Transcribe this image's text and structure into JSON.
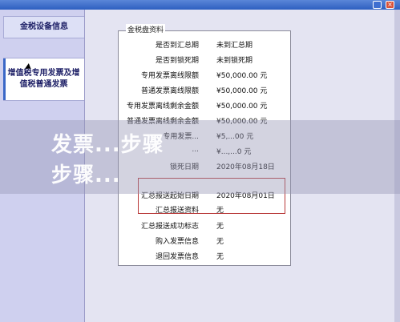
{
  "sidebar": {
    "items": [
      {
        "label": "金税设备信息"
      },
      {
        "label": "增值税专用发票及增值税普通发票"
      }
    ]
  },
  "panel": {
    "title": "金税盘资料",
    "rows": [
      {
        "label": "是否到汇总期",
        "value": "未到汇总期"
      },
      {
        "label": "是否到锁死期",
        "value": "未到锁死期"
      },
      {
        "label": "专用发票离线限额",
        "value": "¥50,000.00 元"
      },
      {
        "label": "普通发票离线限额",
        "value": "¥50,000.00 元"
      },
      {
        "label": "专用发票离线剩余金额",
        "value": "¥50,000.00 元"
      },
      {
        "label": "普通发票离线剩余金额",
        "value": "¥50,000.00 元"
      },
      {
        "label": "专用发票...",
        "value": "¥5,...00 元"
      },
      {
        "label": "...",
        "value": "¥...,...0 元"
      },
      {
        "label": "锁死日期",
        "value": "2020年08月18日"
      },
      {
        "label": "",
        "value": ""
      },
      {
        "label": "汇总报送起始日期",
        "value": "2020年08月01日"
      },
      {
        "label": "汇总报送资料",
        "value": "无"
      },
      {
        "label": "汇总报送成功标志",
        "value": "无"
      },
      {
        "label": "购入发票信息",
        "value": "无"
      },
      {
        "label": "退回发票信息",
        "value": "无"
      }
    ]
  },
  "overlay": {
    "line1": "发票...步骤",
    "line2": "步骤..."
  }
}
